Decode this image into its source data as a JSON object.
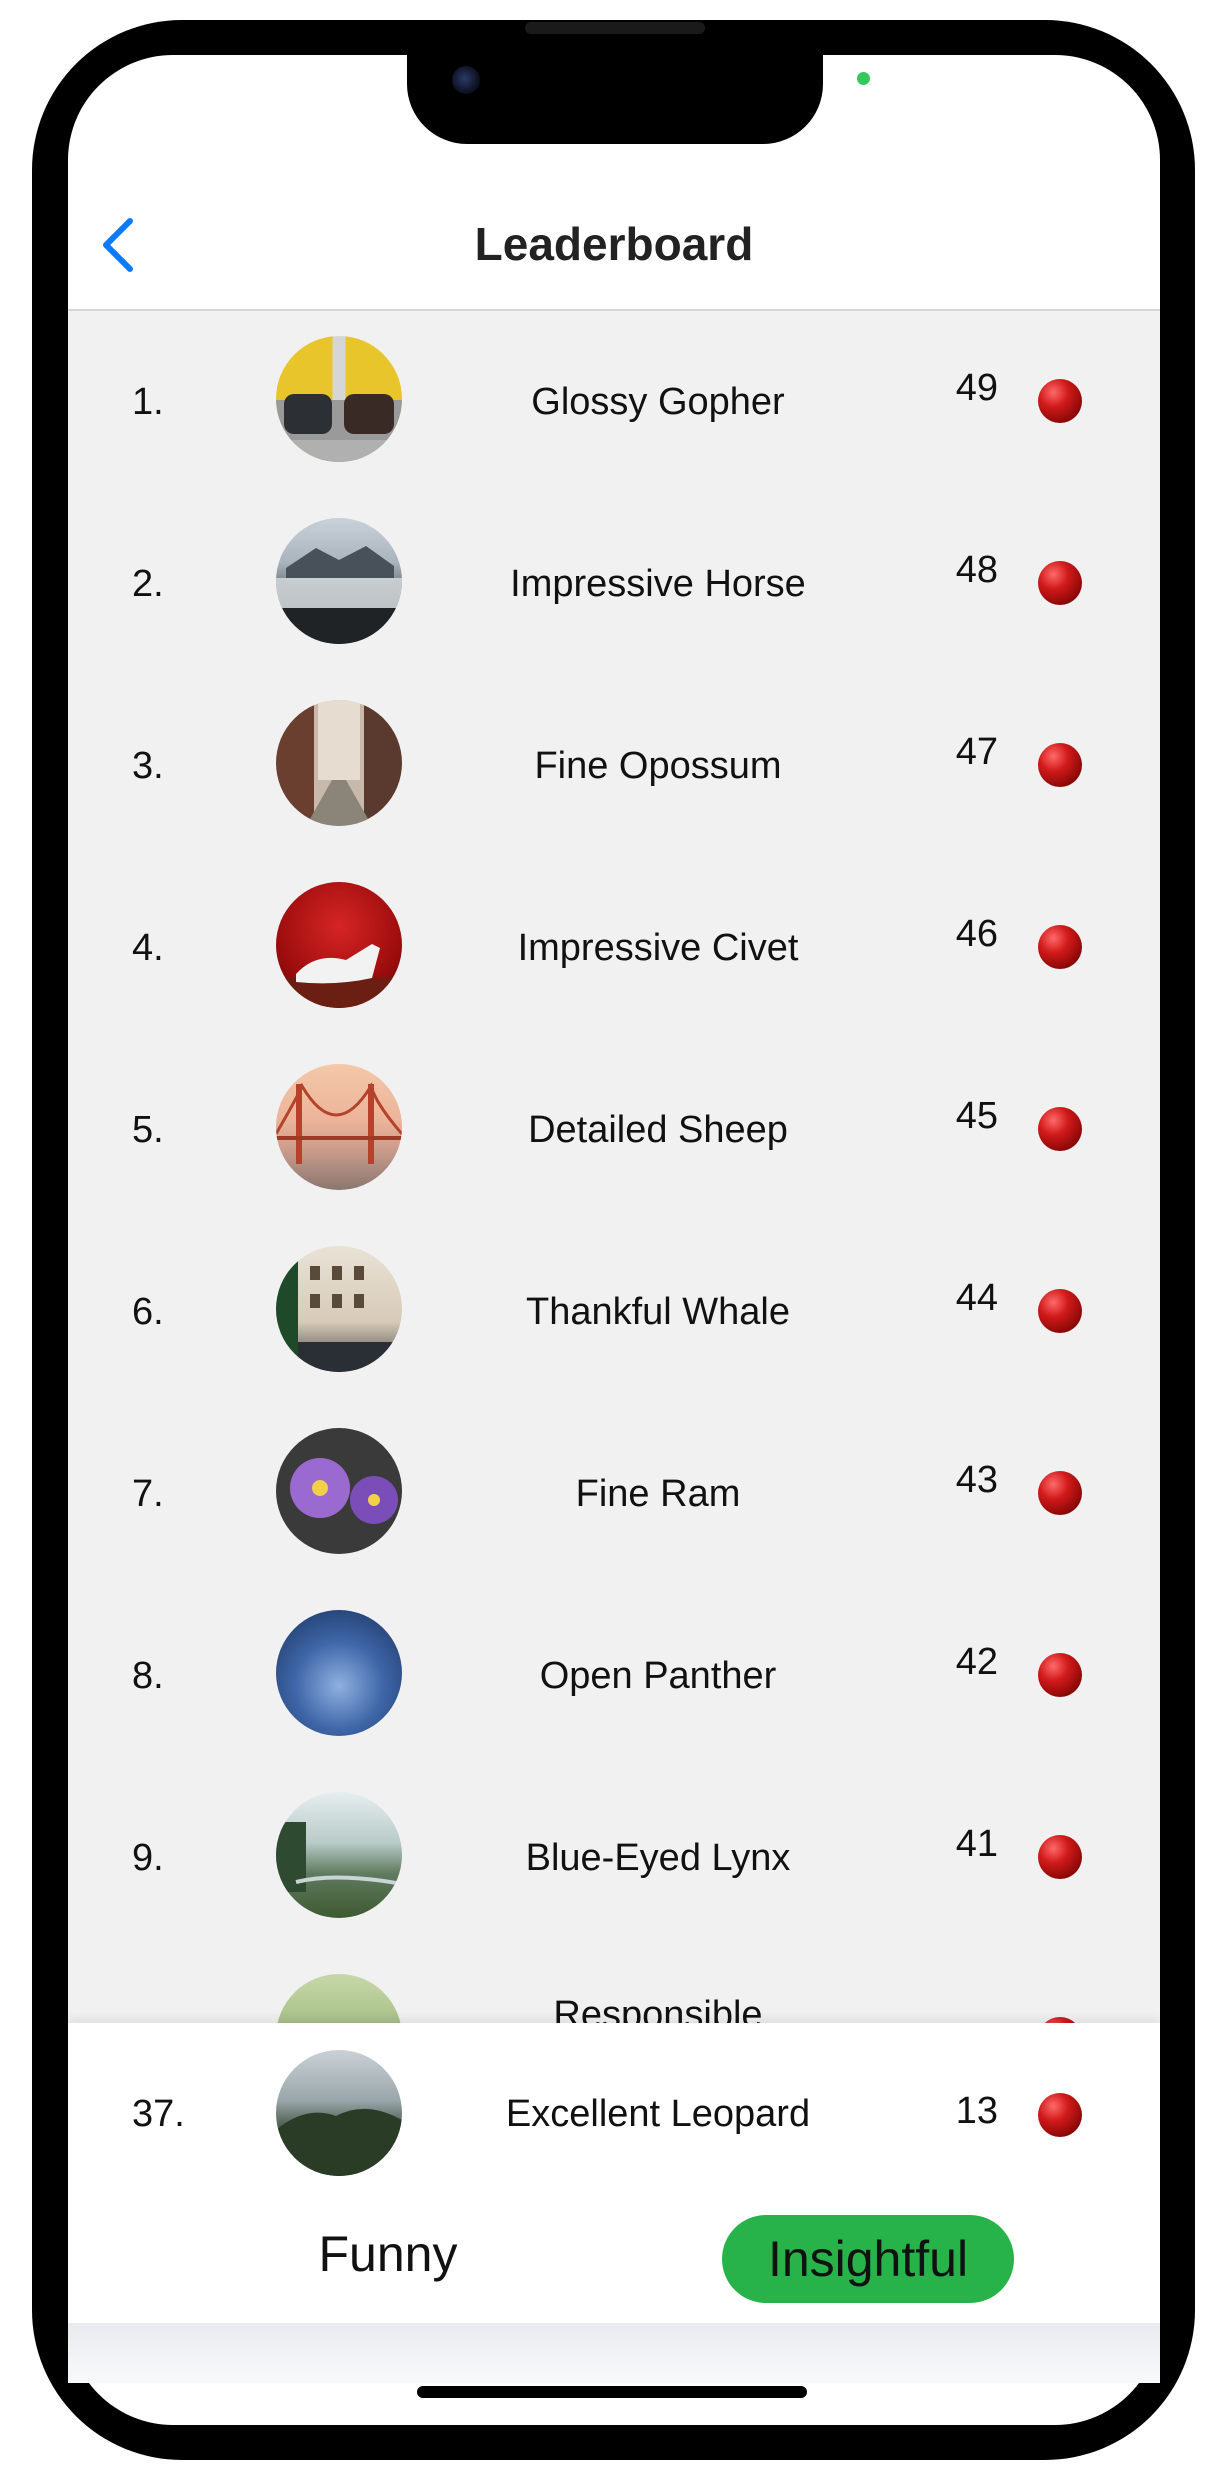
{
  "header": {
    "title": "Leaderboard",
    "back_icon": "chevron-left-icon"
  },
  "colors": {
    "accent": "#0a7aff",
    "active_tab": "#27b34a",
    "list_bg": "#f1f1f1",
    "indicator": "#c41414"
  },
  "entries": [
    {
      "rank": "1.",
      "name": "Glossy Gopher",
      "score": "49",
      "avatar": "cars-garage"
    },
    {
      "rank": "2.",
      "name": "Impressive Horse",
      "score": "48",
      "avatar": "misty-mountain"
    },
    {
      "rank": "3.",
      "name": "Fine Opossum",
      "score": "47",
      "avatar": "city-alley"
    },
    {
      "rank": "4.",
      "name": "Impressive Civet",
      "score": "46",
      "avatar": "white-shoe"
    },
    {
      "rank": "5.",
      "name": "Detailed Sheep",
      "score": "45",
      "avatar": "golden-gate-bridge"
    },
    {
      "rank": "6.",
      "name": "Thankful Whale",
      "score": "44",
      "avatar": "building-street"
    },
    {
      "rank": "7.",
      "name": "Fine Ram",
      "score": "43",
      "avatar": "purple-flowers"
    },
    {
      "rank": "8.",
      "name": "Open Panther",
      "score": "42",
      "avatar": "night-sky"
    },
    {
      "rank": "9.",
      "name": "Blue-Eyed Lynx",
      "score": "41",
      "avatar": "green-landscape"
    },
    {
      "rank": "",
      "name": "Responsible",
      "score": "",
      "avatar": "trees"
    }
  ],
  "current_user": {
    "rank": "37.",
    "name": "Excellent Leopard",
    "score": "13",
    "avatar": "foggy-forest"
  },
  "tabs": [
    {
      "label": "Funny",
      "active": false
    },
    {
      "label": "Insightful",
      "active": true
    }
  ]
}
